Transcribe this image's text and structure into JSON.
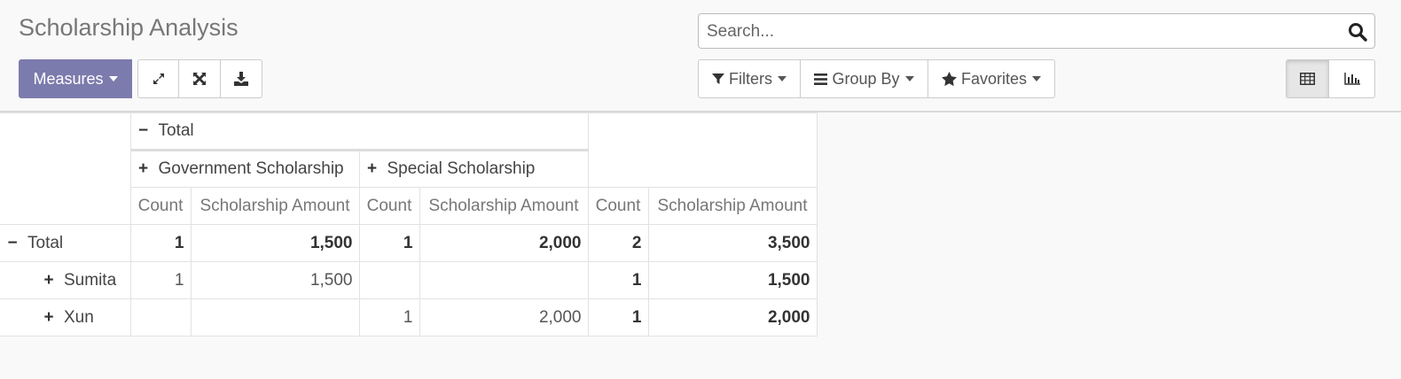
{
  "page_title": "Scholarship Analysis",
  "toolbar": {
    "measures_label": "Measures",
    "expand_icon": "expand-arrows-icon",
    "flip_icon": "flip-axis-icon",
    "download_icon": "download-icon"
  },
  "search": {
    "placeholder": "Search...",
    "icon": "search-icon"
  },
  "filters": {
    "filters_label": "Filters",
    "group_by_label": "Group By",
    "favorites_label": "Favorites"
  },
  "view_switcher": {
    "pivot_icon": "table-icon",
    "graph_icon": "bar-chart-icon",
    "active": "pivot"
  },
  "colors": {
    "primary": "#7c7bad",
    "background": "#f9f9f9"
  },
  "pivot": {
    "col_total_label": "Total",
    "col_groups": [
      "Government Scholarship",
      "Special Scholarship"
    ],
    "measures": [
      "Count",
      "Scholarship Amount",
      "Count",
      "Scholarship Amount",
      "Count",
      "Scholarship Amount"
    ],
    "rows": [
      {
        "sign": "−",
        "label": "Total",
        "cells": [
          "1",
          "1,500",
          "1",
          "2,000",
          "2",
          "3,500"
        ]
      },
      {
        "sign": "+",
        "label": "Sumita",
        "cells": [
          "1",
          "1,500",
          "",
          "",
          "1",
          "1,500"
        ]
      },
      {
        "sign": "+",
        "label": "Xun",
        "cells": [
          "",
          "",
          "1",
          "2,000",
          "1",
          "2,000"
        ]
      }
    ]
  }
}
